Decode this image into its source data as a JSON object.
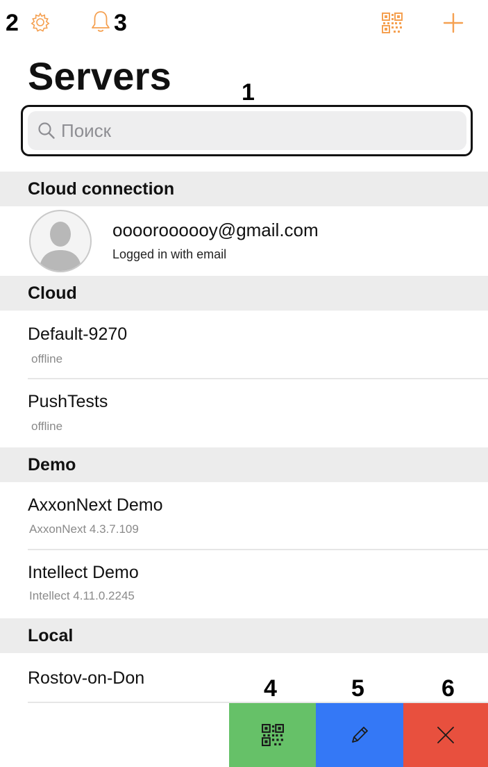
{
  "callouts": [
    "1",
    "2",
    "3",
    "4",
    "5",
    "6"
  ],
  "toolbar": {
    "settings_icon": "gear-icon",
    "notifications_icon": "bell-icon",
    "qr_scan_icon": "qr-code-icon",
    "add_icon": "plus-icon",
    "accent_color": "#f5a050"
  },
  "page": {
    "title": "Servers"
  },
  "search": {
    "placeholder": "Поиск",
    "value": ""
  },
  "sections": {
    "cloud_connection": {
      "title": "Cloud connection",
      "account": {
        "email": "ooooroooooy@gmail.com",
        "status": "Logged in with email"
      }
    },
    "cloud": {
      "title": "Cloud",
      "items": [
        {
          "name": "Default-9270",
          "status": "offline"
        },
        {
          "name": "PushTests",
          "status": "offline"
        }
      ]
    },
    "demo": {
      "title": "Demo",
      "items": [
        {
          "name": "AxxonNext Demo",
          "version": "AxxonNext 4.3.7.109"
        },
        {
          "name": "Intellect Demo",
          "version": "Intellect 4.11.0.2245"
        }
      ]
    },
    "local": {
      "title": "Local",
      "items": [
        {
          "name": "Rostov-on-Don"
        }
      ]
    }
  },
  "actions": {
    "qr": {
      "icon": "qr-code-icon",
      "color": "#66c168"
    },
    "edit": {
      "icon": "pencil-icon",
      "color": "#3478f6"
    },
    "delete": {
      "icon": "close-icon",
      "color": "#e8503e"
    }
  }
}
